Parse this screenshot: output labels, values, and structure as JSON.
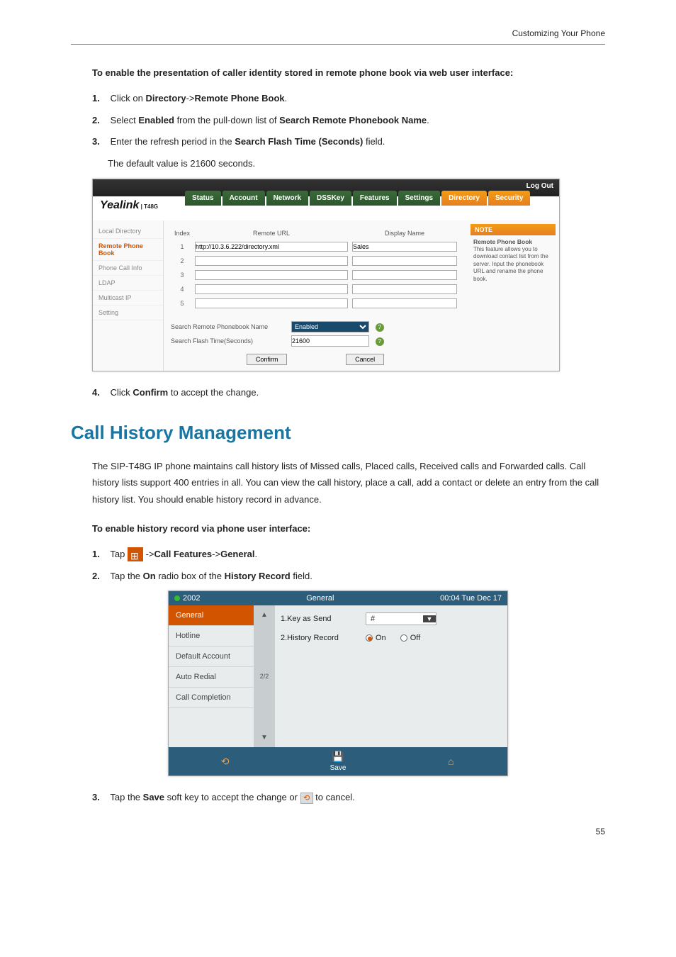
{
  "page_header": "Customizing Your Phone",
  "intro_heading": "To enable the presentation of caller identity stored in remote phone book via web user interface:",
  "steps_web": {
    "s1_pre": "Click on ",
    "s1_b1": "Directory",
    "s1_mid": "->",
    "s1_b2": "Remote Phone Book",
    "s1_post": ".",
    "s2_pre": "Select ",
    "s2_b1": "Enabled",
    "s2_mid": " from the pull-down list of ",
    "s2_b2": "Search Remote Phonebook Name",
    "s2_post": ".",
    "s3_pre": "Enter the refresh period in the ",
    "s3_b1": "Search Flash Time (Seconds)",
    "s3_post": " field.",
    "s3_note": "The default value is 21600 seconds.",
    "s4_pre": "Click ",
    "s4_b1": "Confirm",
    "s4_post": " to accept the change."
  },
  "webui": {
    "logout": "Log Out",
    "logo": "Yealink",
    "logo_sub": "T48G",
    "tabs": [
      "Status",
      "Account",
      "Network",
      "DSSKey",
      "Features",
      "Settings",
      "Directory",
      "Security"
    ],
    "active_tab": "Directory",
    "sidebar": [
      "Local Directory",
      "Remote Phone Book",
      "Phone Call Info",
      "LDAP",
      "Multicast IP",
      "Setting"
    ],
    "active_side": "Remote Phone Book",
    "col_index": "Index",
    "col_url": "Remote URL",
    "col_name": "Display Name",
    "rows": [
      {
        "idx": "1",
        "url": "http://10.3.6.222/directory.xml",
        "name": "Sales"
      },
      {
        "idx": "2",
        "url": "",
        "name": ""
      },
      {
        "idx": "3",
        "url": "",
        "name": ""
      },
      {
        "idx": "4",
        "url": "",
        "name": ""
      },
      {
        "idx": "5",
        "url": "",
        "name": ""
      }
    ],
    "search_label": "Search Remote Phonebook Name",
    "search_value": "Enabled",
    "flash_label": "Search Flash Time(Seconds)",
    "flash_value": "21600",
    "confirm_btn": "Confirm",
    "cancel_btn": "Cancel",
    "note_head": "NOTE",
    "note_title": "Remote Phone Book",
    "note_body": "This feature allows you to download contact list from the server. Input the phonebook URL and rename the phone book."
  },
  "section_heading": "Call History Management",
  "section_para": "The SIP-T48G IP phone maintains call history lists of Missed calls, Placed calls, Received calls and Forwarded calls. Call history lists support 400 entries in all. You can view the call history, place a call, add a contact or delete an entry from the call history list. You should enable history record in advance.",
  "phone_intro": "To enable history record via phone user interface:",
  "steps_phone": {
    "s1_pre": "Tap ",
    "s1_mid": " ->",
    "s1_b1": "Call Features",
    "s1_mid2": "->",
    "s1_b2": "General",
    "s1_post": ".",
    "s2_pre": "Tap the ",
    "s2_b1": "On",
    "s2_mid": " radio box of the ",
    "s2_b2": "History Record",
    "s2_post": " field.",
    "s3_pre": "Tap the ",
    "s3_b1": "Save",
    "s3_mid": " soft key to accept the change or ",
    "s3_post": " to cancel."
  },
  "phone_ui": {
    "account": "2002",
    "title": "General",
    "time": "00:04 Tue Dec 17",
    "side": [
      "General",
      "Hotline",
      "Default Account",
      "Auto Redial",
      "Call Completion"
    ],
    "active_side": "General",
    "page_ind": "2/2",
    "row1_label": "1.Key as Send",
    "row1_value": "#",
    "row2_label": "2.History Record",
    "row2_on": "On",
    "row2_off": "Off",
    "save_label": "Save"
  },
  "page_number": "55"
}
